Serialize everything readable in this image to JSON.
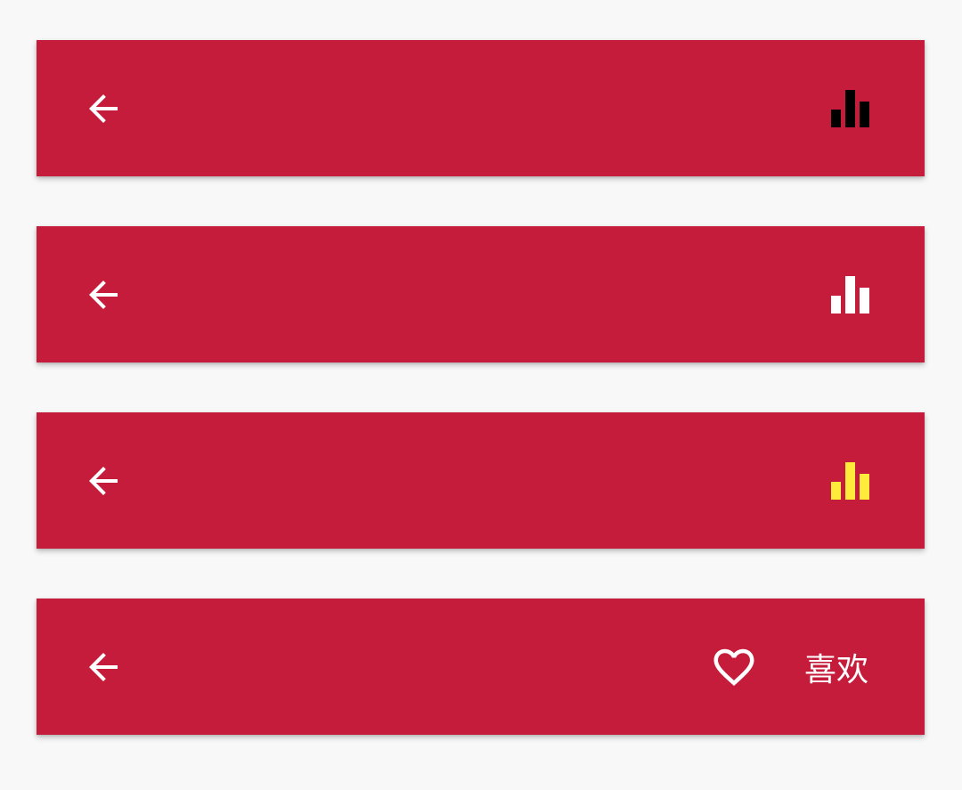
{
  "toolbars": [
    {
      "back_icon": "arrow-back-icon",
      "action_icon": "equalizer-icon",
      "action_icon_color": "#000000"
    },
    {
      "back_icon": "arrow-back-icon",
      "action_icon": "equalizer-icon",
      "action_icon_color": "#ffffff"
    },
    {
      "back_icon": "arrow-back-icon",
      "action_icon": "equalizer-icon",
      "action_icon_color": "#ffeb3b"
    },
    {
      "back_icon": "arrow-back-icon",
      "action_icon": "heart-outline-icon",
      "action_label": "喜欢",
      "action_icon_color": "#ffffff"
    }
  ],
  "colors": {
    "toolbar_background": "#c61c3b",
    "page_background": "#f8f8f8",
    "icon_default": "#ffffff"
  }
}
